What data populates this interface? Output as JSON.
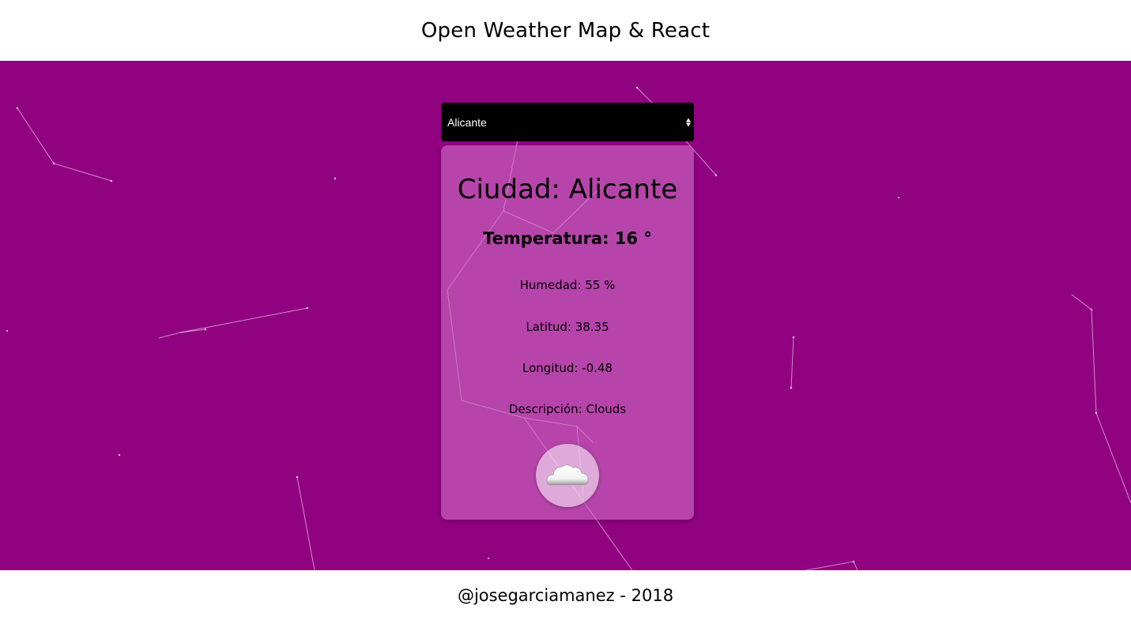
{
  "header": {
    "title": "Open Weather Map & React"
  },
  "city_select": {
    "selected": "Alicante"
  },
  "weather": {
    "city_line": "Ciudad: Alicante",
    "temperature_line": "Temperatura: 16 °",
    "humidity_line": "Humedad: 55 %",
    "latitude_line": "Latitud: 38.35",
    "longitude_line": "Longitud: -0.48",
    "description_line": "Descripción: Clouds",
    "icon": "cloud-icon"
  },
  "footer": {
    "credit": "@josegarciamanez - 2018"
  },
  "colors": {
    "background": "#910281",
    "card": "#cf6ec3",
    "select_bg": "#000000"
  }
}
